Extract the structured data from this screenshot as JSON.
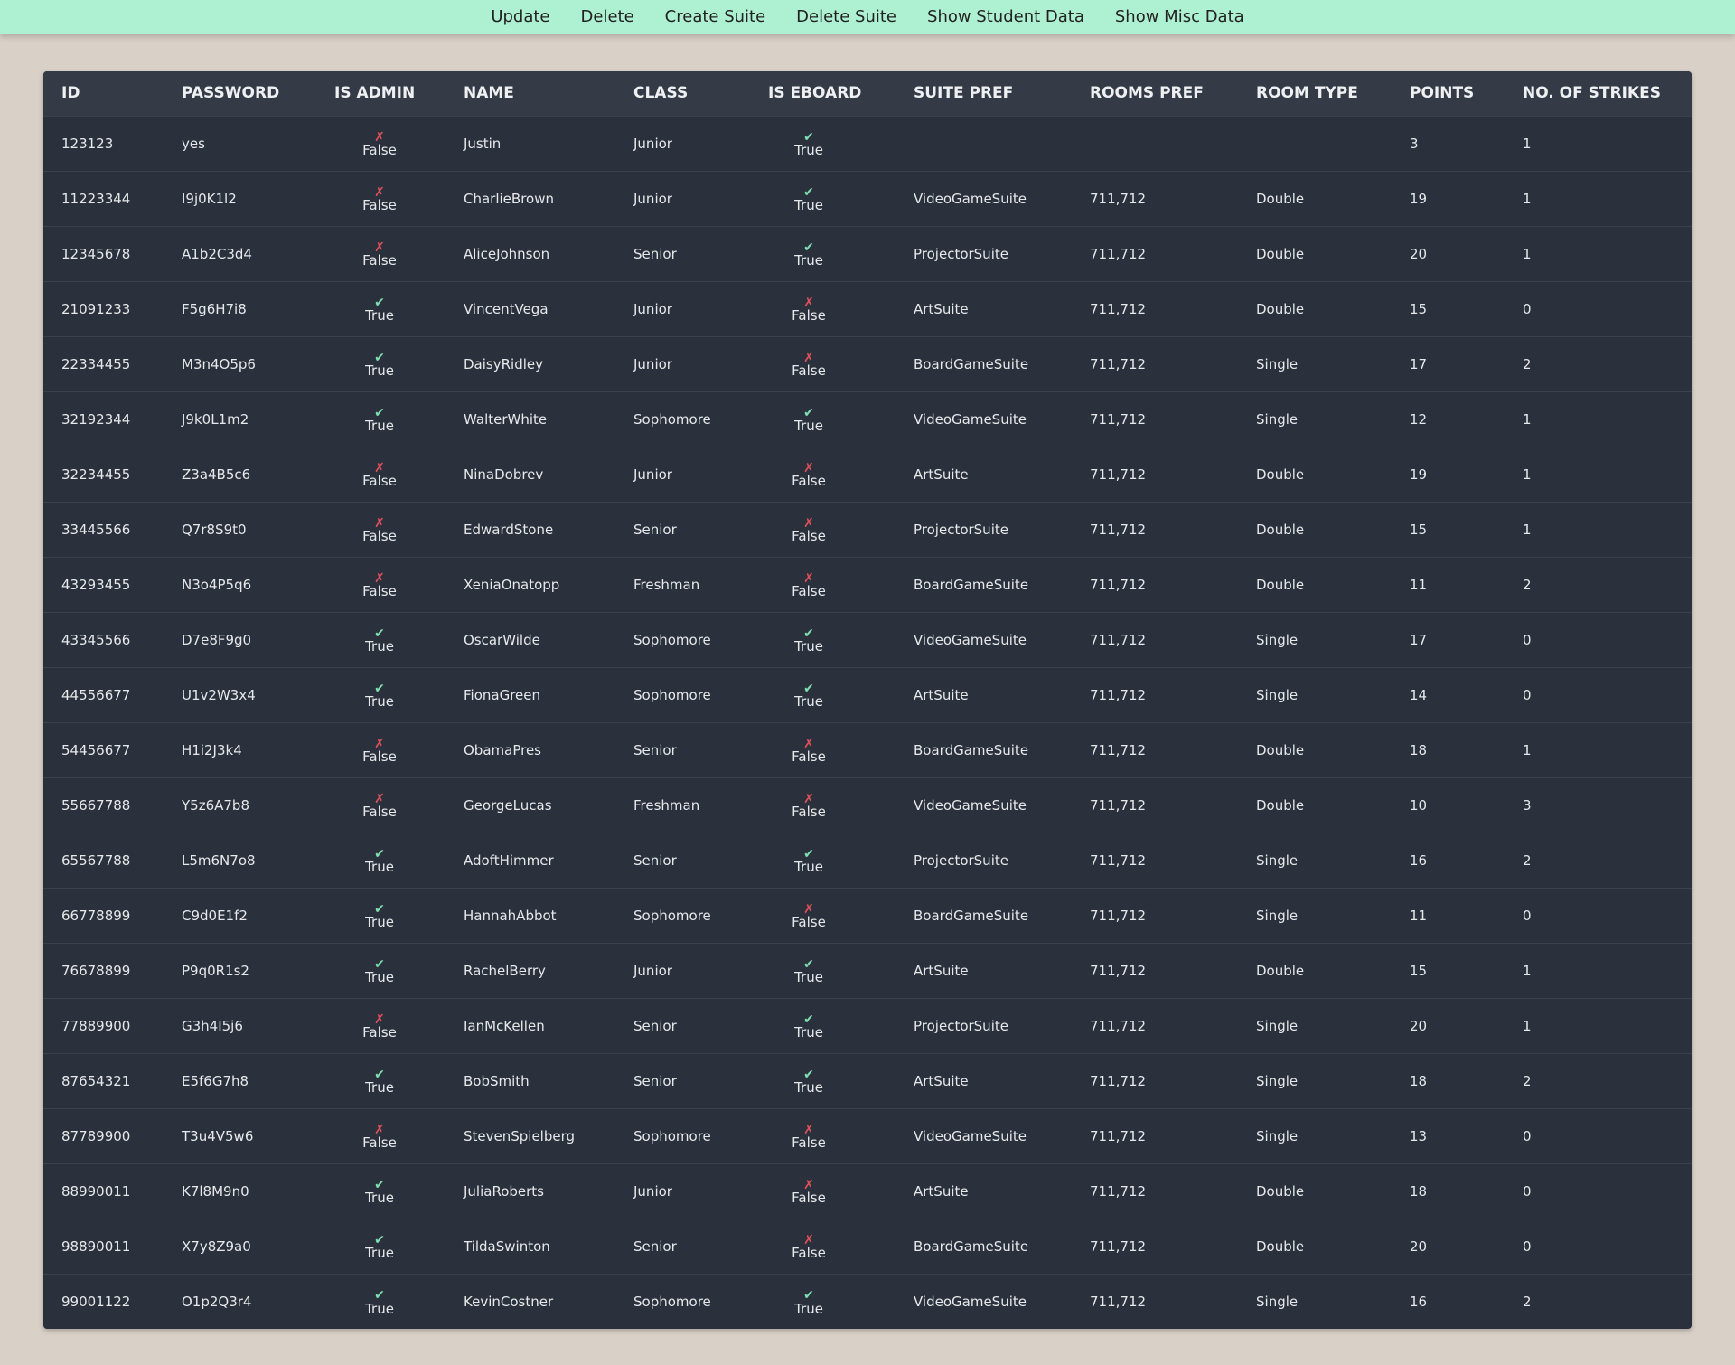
{
  "nav": {
    "buttons": [
      "Update",
      "Delete",
      "Create Suite",
      "Delete Suite",
      "Show Student Data",
      "Show Misc Data"
    ]
  },
  "colors": {
    "nav_bg": "#aef0d2",
    "page_bg": "#d9d1c7",
    "table_bg": "#2b313c",
    "true_mark": "#7ee0b0",
    "false_mark": "#e0505a"
  },
  "icons": {
    "true": "check-icon",
    "false": "cross-icon"
  },
  "table": {
    "headers": [
      "ID",
      "PASSWORD",
      "IS ADMIN",
      "NAME",
      "CLASS",
      "IS EBOARD",
      "SUITE PREF",
      "ROOMS PREF",
      "ROOM TYPE",
      "POINTS",
      "NO. OF STRIKES"
    ],
    "rows": [
      {
        "id": "123123",
        "password": "yes",
        "is_admin": "False",
        "name": "Justin",
        "class": "Junior",
        "is_eboard": "True",
        "suite_pref": "",
        "rooms_pref": "",
        "room_type": "",
        "points": "3",
        "strikes": "1"
      },
      {
        "id": "11223344",
        "password": "I9j0K1l2",
        "is_admin": "False",
        "name": "CharlieBrown",
        "class": "Junior",
        "is_eboard": "True",
        "suite_pref": "VideoGameSuite",
        "rooms_pref": "711,712",
        "room_type": "Double",
        "points": "19",
        "strikes": "1"
      },
      {
        "id": "12345678",
        "password": "A1b2C3d4",
        "is_admin": "False",
        "name": "AliceJohnson",
        "class": "Senior",
        "is_eboard": "True",
        "suite_pref": "ProjectorSuite",
        "rooms_pref": "711,712",
        "room_type": "Double",
        "points": "20",
        "strikes": "1"
      },
      {
        "id": "21091233",
        "password": "F5g6H7i8",
        "is_admin": "True",
        "name": "VincentVega",
        "class": "Junior",
        "is_eboard": "False",
        "suite_pref": "ArtSuite",
        "rooms_pref": "711,712",
        "room_type": "Double",
        "points": "15",
        "strikes": "0"
      },
      {
        "id": "22334455",
        "password": "M3n4O5p6",
        "is_admin": "True",
        "name": "DaisyRidley",
        "class": "Junior",
        "is_eboard": "False",
        "suite_pref": "BoardGameSuite",
        "rooms_pref": "711,712",
        "room_type": "Single",
        "points": "17",
        "strikes": "2"
      },
      {
        "id": "32192344",
        "password": "J9k0L1m2",
        "is_admin": "True",
        "name": "WalterWhite",
        "class": "Sophomore",
        "is_eboard": "True",
        "suite_pref": "VideoGameSuite",
        "rooms_pref": "711,712",
        "room_type": "Single",
        "points": "12",
        "strikes": "1"
      },
      {
        "id": "32234455",
        "password": "Z3a4B5c6",
        "is_admin": "False",
        "name": "NinaDobrev",
        "class": "Junior",
        "is_eboard": "False",
        "suite_pref": "ArtSuite",
        "rooms_pref": "711,712",
        "room_type": "Double",
        "points": "19",
        "strikes": "1"
      },
      {
        "id": "33445566",
        "password": "Q7r8S9t0",
        "is_admin": "False",
        "name": "EdwardStone",
        "class": "Senior",
        "is_eboard": "False",
        "suite_pref": "ProjectorSuite",
        "rooms_pref": "711,712",
        "room_type": "Double",
        "points": "15",
        "strikes": "1"
      },
      {
        "id": "43293455",
        "password": "N3o4P5q6",
        "is_admin": "False",
        "name": "XeniaOnatopp",
        "class": "Freshman",
        "is_eboard": "False",
        "suite_pref": "BoardGameSuite",
        "rooms_pref": "711,712",
        "room_type": "Double",
        "points": "11",
        "strikes": "2"
      },
      {
        "id": "43345566",
        "password": "D7e8F9g0",
        "is_admin": "True",
        "name": "OscarWilde",
        "class": "Sophomore",
        "is_eboard": "True",
        "suite_pref": "VideoGameSuite",
        "rooms_pref": "711,712",
        "room_type": "Single",
        "points": "17",
        "strikes": "0"
      },
      {
        "id": "44556677",
        "password": "U1v2W3x4",
        "is_admin": "True",
        "name": "FionaGreen",
        "class": "Sophomore",
        "is_eboard": "True",
        "suite_pref": "ArtSuite",
        "rooms_pref": "711,712",
        "room_type": "Single",
        "points": "14",
        "strikes": "0"
      },
      {
        "id": "54456677",
        "password": "H1i2J3k4",
        "is_admin": "False",
        "name": "ObamaPres",
        "class": "Senior",
        "is_eboard": "False",
        "suite_pref": "BoardGameSuite",
        "rooms_pref": "711,712",
        "room_type": "Double",
        "points": "18",
        "strikes": "1"
      },
      {
        "id": "55667788",
        "password": "Y5z6A7b8",
        "is_admin": "False",
        "name": "GeorgeLucas",
        "class": "Freshman",
        "is_eboard": "False",
        "suite_pref": "VideoGameSuite",
        "rooms_pref": "711,712",
        "room_type": "Double",
        "points": "10",
        "strikes": "3"
      },
      {
        "id": "65567788",
        "password": "L5m6N7o8",
        "is_admin": "True",
        "name": "AdoftHimmer",
        "class": "Senior",
        "is_eboard": "True",
        "suite_pref": "ProjectorSuite",
        "rooms_pref": "711,712",
        "room_type": "Single",
        "points": "16",
        "strikes": "2"
      },
      {
        "id": "66778899",
        "password": "C9d0E1f2",
        "is_admin": "True",
        "name": "HannahAbbot",
        "class": "Sophomore",
        "is_eboard": "False",
        "suite_pref": "BoardGameSuite",
        "rooms_pref": "711,712",
        "room_type": "Single",
        "points": "11",
        "strikes": "0"
      },
      {
        "id": "76678899",
        "password": "P9q0R1s2",
        "is_admin": "True",
        "name": "RachelBerry",
        "class": "Junior",
        "is_eboard": "True",
        "suite_pref": "ArtSuite",
        "rooms_pref": "711,712",
        "room_type": "Double",
        "points": "15",
        "strikes": "1"
      },
      {
        "id": "77889900",
        "password": "G3h4I5j6",
        "is_admin": "False",
        "name": "IanMcKellen",
        "class": "Senior",
        "is_eboard": "True",
        "suite_pref": "ProjectorSuite",
        "rooms_pref": "711,712",
        "room_type": "Single",
        "points": "20",
        "strikes": "1"
      },
      {
        "id": "87654321",
        "password": "E5f6G7h8",
        "is_admin": "True",
        "name": "BobSmith",
        "class": "Senior",
        "is_eboard": "True",
        "suite_pref": "ArtSuite",
        "rooms_pref": "711,712",
        "room_type": "Single",
        "points": "18",
        "strikes": "2"
      },
      {
        "id": "87789900",
        "password": "T3u4V5w6",
        "is_admin": "False",
        "name": "StevenSpielberg",
        "class": "Sophomore",
        "is_eboard": "False",
        "suite_pref": "VideoGameSuite",
        "rooms_pref": "711,712",
        "room_type": "Single",
        "points": "13",
        "strikes": "0"
      },
      {
        "id": "88990011",
        "password": "K7l8M9n0",
        "is_admin": "True",
        "name": "JuliaRoberts",
        "class": "Junior",
        "is_eboard": "False",
        "suite_pref": "ArtSuite",
        "rooms_pref": "711,712",
        "room_type": "Double",
        "points": "18",
        "strikes": "0"
      },
      {
        "id": "98890011",
        "password": "X7y8Z9a0",
        "is_admin": "True",
        "name": "TildaSwinton",
        "class": "Senior",
        "is_eboard": "False",
        "suite_pref": "BoardGameSuite",
        "rooms_pref": "711,712",
        "room_type": "Double",
        "points": "20",
        "strikes": "0"
      },
      {
        "id": "99001122",
        "password": "O1p2Q3r4",
        "is_admin": "True",
        "name": "KevinCostner",
        "class": "Sophomore",
        "is_eboard": "True",
        "suite_pref": "VideoGameSuite",
        "rooms_pref": "711,712",
        "room_type": "Single",
        "points": "16",
        "strikes": "2"
      }
    ]
  }
}
